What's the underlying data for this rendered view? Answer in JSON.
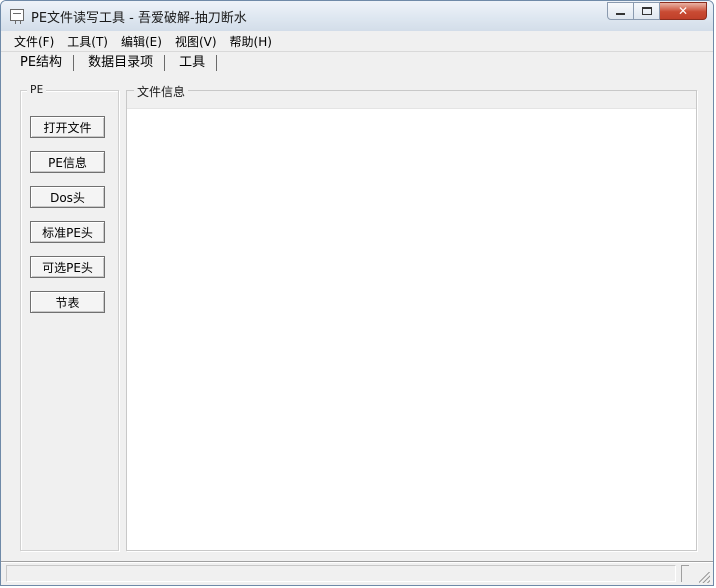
{
  "window": {
    "title": "PE文件读写工具 - 吾爱破解-抽刀断水"
  },
  "caption_buttons": {
    "minimize_icon": "minimize-icon",
    "maximize_icon": "maximize-icon",
    "close_glyph": "✕"
  },
  "menubar": {
    "items": [
      {
        "label": "文件(F)"
      },
      {
        "label": "工具(T)"
      },
      {
        "label": "编辑(E)"
      },
      {
        "label": "视图(V)"
      },
      {
        "label": "帮助(H)"
      }
    ]
  },
  "tabs": [
    {
      "label": "PE结构"
    },
    {
      "label": "数据目录项"
    },
    {
      "label": "工具"
    }
  ],
  "pe_group": {
    "legend": "PE",
    "buttons": [
      {
        "label": "打开文件"
      },
      {
        "label": "PE信息"
      },
      {
        "label": "Dos头"
      },
      {
        "label": "标准PE头"
      },
      {
        "label": "可选PE头"
      },
      {
        "label": "节表"
      }
    ]
  },
  "info_group": {
    "legend": "文件信息"
  },
  "colors": {
    "window_bg": "#f0f0f0",
    "close_button": "#c94b33",
    "titlebar": "#dde6f0"
  }
}
